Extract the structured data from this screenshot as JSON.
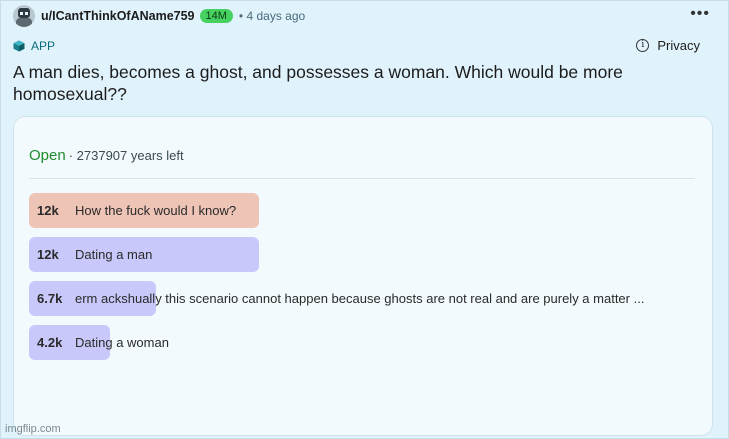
{
  "post": {
    "username": "u/ICantThinkOfAName759",
    "karma": "14M",
    "time": "• 4 days ago",
    "menu_icon": "•••",
    "flair": "APP",
    "flair_icon": "cube-icon",
    "privacy_label": "Privacy",
    "privacy_icon": "info-icon",
    "title": "A man dies, becomes a ghost, and possesses a woman. Which would be more homosexual??"
  },
  "poll": {
    "status": "Open",
    "time_left": "· 2737907 years left",
    "options": [
      {
        "count": "12k",
        "label": "How the fuck would I know?",
        "fraction": 1.0,
        "color": "#eec4b7"
      },
      {
        "count": "12k",
        "label": "Dating a man",
        "fraction": 1.0,
        "color": "#c9c8fb"
      },
      {
        "count": "6.7k",
        "label": "erm ackshually this scenario cannot happen because ghosts are not real and are purely a matter ...",
        "fraction": 0.55,
        "color": "#c9c8fb"
      },
      {
        "count": "4.2k",
        "label": "Dating a woman",
        "fraction": 0.35,
        "color": "#c9c8fb"
      }
    ]
  },
  "watermark": "imgflip.com",
  "colors": {
    "accent_open": "#1f8b2c",
    "karma_badge": "#46d160",
    "background": "#e0f2fc"
  }
}
